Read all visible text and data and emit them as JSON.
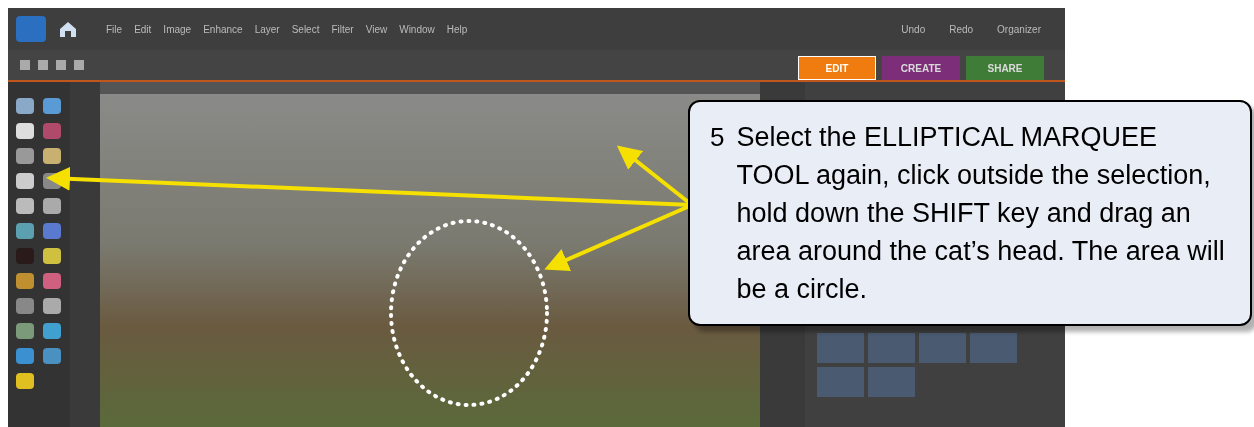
{
  "menu": [
    "File",
    "Edit",
    "Image",
    "Enhance",
    "Layer",
    "Select",
    "Filter",
    "View",
    "Window",
    "Help"
  ],
  "top_buttons": [
    "Undo",
    "Redo",
    "Organizer"
  ],
  "panel_tabs": [
    {
      "label": "EDIT",
      "selected": true,
      "color": "#f07c10"
    },
    {
      "label": "CREATE",
      "selected": false,
      "color": "#8a2a86"
    },
    {
      "label": "SHARE",
      "selected": false,
      "color": "#3f8a34"
    }
  ],
  "callout": {
    "step": "5",
    "text": "Select the ELLIPTICAL MARQUEE TOOL again, click outside the selection, hold down the SHIFT key and drag an area around the cat’s head.  The area will be a circle."
  }
}
